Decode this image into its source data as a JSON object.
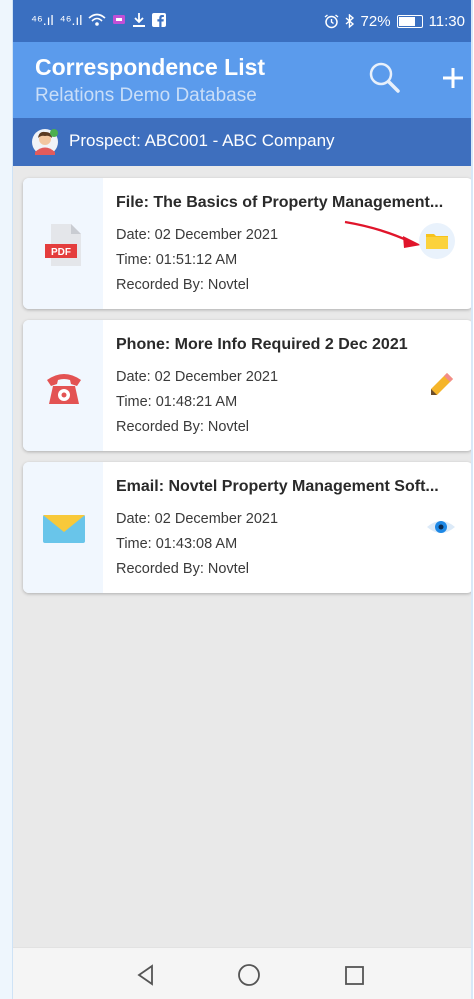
{
  "status_bar": {
    "signal_1": "⁴⁶.ıl",
    "signal_2": "⁴⁶.ıl",
    "wifi_icon": "wifi-icon",
    "right_text": "72%",
    "time": "11:30"
  },
  "app_bar": {
    "title": "Correspondence List",
    "subtitle": "Relations Demo Database"
  },
  "prospect": {
    "label": "Prospect: ABC001 - ABC Company"
  },
  "cards": [
    {
      "title": "File: The Basics of Property Management...",
      "date": "Date: 02 December 2021",
      "time": "Time: 01:51:12 AM",
      "recorded_by": "Recorded By: Novtel",
      "icon": "pdf-icon",
      "action_icon": "folder-icon"
    },
    {
      "title": "Phone: More Info Required 2 Dec 2021",
      "date": "Date: 02 December 2021",
      "time": "Time: 01:48:21 AM",
      "recorded_by": "Recorded By: Novtel",
      "icon": "phone-icon",
      "action_icon": "pencil-icon"
    },
    {
      "title": "Email: Novtel Property Management Soft...",
      "date": "Date: 02 December 2021",
      "time": "Time: 01:43:08 AM",
      "recorded_by": "Recorded By: Novtel",
      "icon": "envelope-icon",
      "action_icon": "eye-icon"
    }
  ],
  "colors": {
    "status_bar": "#3a6fc0",
    "app_bar": "#5b9bec",
    "prospect_bar": "#3e6fbe",
    "annotation_arrow": "#e0152b"
  }
}
